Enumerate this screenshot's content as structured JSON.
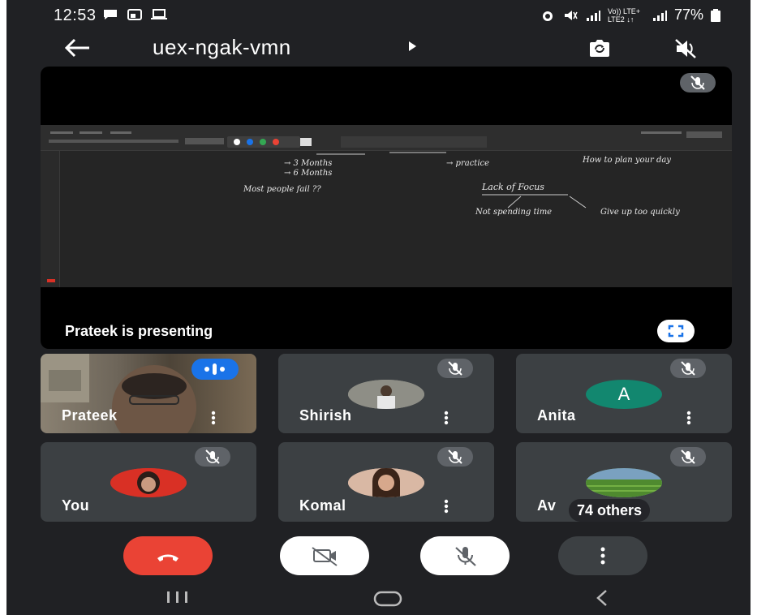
{
  "status_bar": {
    "time": "12:53",
    "carrier": "Vo)) LTE+ LTE2 ↓↑",
    "battery": "77%",
    "icons": [
      "message-icon",
      "cast-icon",
      "laptop-icon",
      "alarm-icon",
      "mute-icon",
      "signal-icon",
      "battery-icon"
    ]
  },
  "app_bar": {
    "meeting_code": "uex-ngak-vmn",
    "icons": [
      "back-arrow-icon",
      "chevron-right-icon",
      "camera-switch-icon",
      "speaker-off-icon"
    ]
  },
  "presentation": {
    "label": "Prateek is presenting",
    "whiteboard_notes": [
      "→ 3 Months",
      "→ 6 Months",
      "Most people fail ??",
      "→ practice",
      "How to plan your day",
      "Lack of Focus",
      "Not spending time",
      "Give up too quickly"
    ]
  },
  "participants": [
    {
      "name": "Prateek",
      "muted": false,
      "speaking": true,
      "video": true
    },
    {
      "name": "Shirish",
      "muted": true
    },
    {
      "name": "Anita",
      "muted": true,
      "initial": "A",
      "avatar_color": "#12876f"
    },
    {
      "name": "You",
      "muted": true
    },
    {
      "name": "Komal",
      "muted": true
    },
    {
      "name": "Av",
      "muted": true,
      "overlay": "74 others"
    }
  ],
  "controls": {
    "items": [
      "end-call-button",
      "camera-off-button",
      "mic-off-button",
      "more-options-button"
    ]
  },
  "colors": {
    "background": "#202124",
    "tile": "#3c4043",
    "end_call": "#ea4335",
    "accent_blue": "#1a73e8",
    "avatar_green": "#12876f"
  }
}
